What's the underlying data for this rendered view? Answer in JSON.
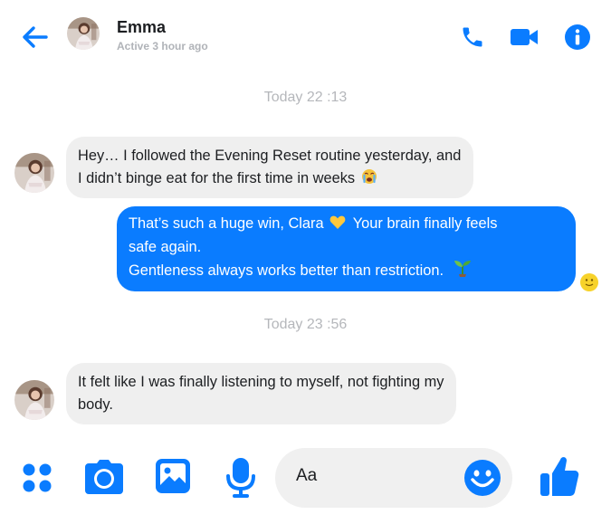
{
  "colors": {
    "accent": "#0a7cff",
    "incoming_bubble": "#efefef",
    "muted": "#b5b7bb"
  },
  "header": {
    "back_icon": "arrow-left-icon",
    "contact_name": "Emma",
    "status": "Active 3 hour ago",
    "actions": [
      {
        "icon": "phone-icon"
      },
      {
        "icon": "video-camera-icon"
      },
      {
        "icon": "info-icon"
      }
    ]
  },
  "conversation": {
    "timestamps": [
      "Today 22 :13",
      "Today 23 :56"
    ],
    "messages": [
      {
        "direction": "incoming",
        "lines": [
          "Hey… I followed the Evening Reset routine yesterday, and",
          "I didn’t binge eat for the first time in weeks"
        ],
        "emoji": "crying-face-emoji"
      },
      {
        "direction": "outgoing",
        "line1_text": "That’s such a huge win, Clara",
        "line1_emoji": "yellow-heart-emoji",
        "line1_rest": "Your brain finally feels",
        "line2": "safe again.",
        "line3_text": "Gentleness always works better than restriction.",
        "line3_emoji": "seedling-emoji"
      },
      {
        "direction": "incoming",
        "lines": [
          "It felt like I was finally listening to myself, not fighting my",
          "body."
        ]
      }
    ],
    "seen_indicator": "seen-reaction-icon"
  },
  "composer": {
    "icons": [
      "apps-grid-icon",
      "camera-icon",
      "image-icon",
      "microphone-icon",
      "smiley-icon",
      "thumbs-up-icon"
    ],
    "placeholder": "Aa"
  }
}
